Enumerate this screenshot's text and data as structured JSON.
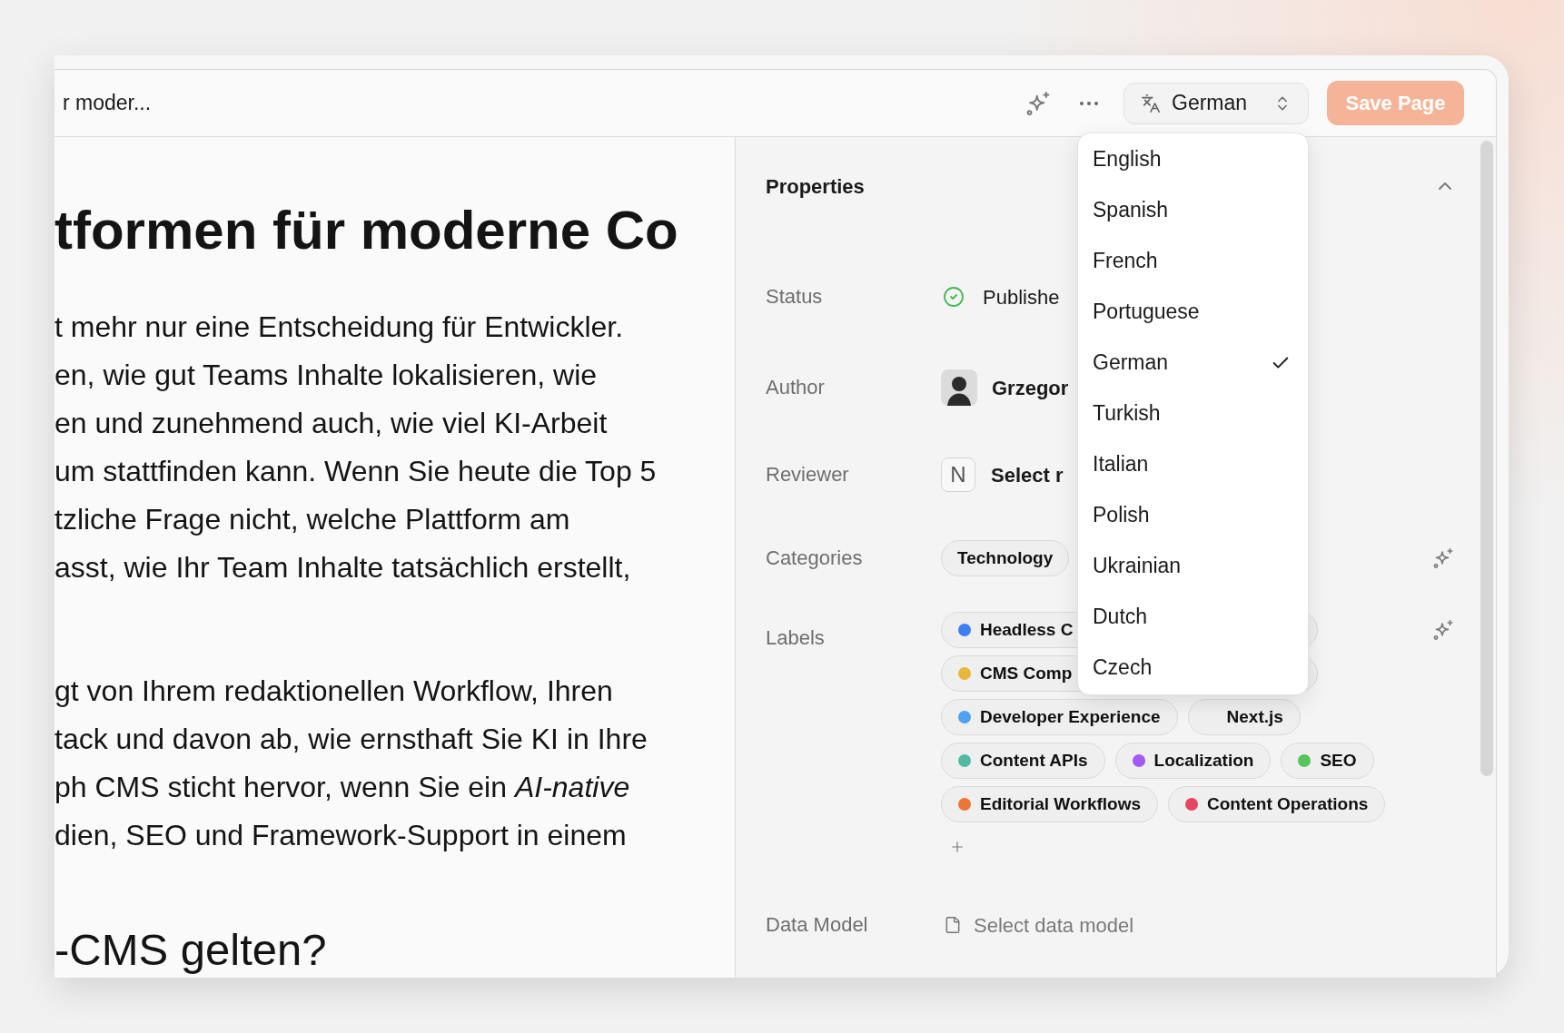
{
  "window": {
    "title": "r moder..."
  },
  "toolbar": {
    "language_select": {
      "value": "German"
    },
    "save_button": {
      "label": "Save Page",
      "disabled": true
    }
  },
  "language_menu": {
    "options": [
      {
        "label": "English",
        "selected": false
      },
      {
        "label": "Spanish",
        "selected": false
      },
      {
        "label": "French",
        "selected": false
      },
      {
        "label": "Portuguese",
        "selected": false
      },
      {
        "label": "German",
        "selected": true
      },
      {
        "label": "Turkish",
        "selected": false
      },
      {
        "label": "Italian",
        "selected": false
      },
      {
        "label": "Polish",
        "selected": false
      },
      {
        "label": "Ukrainian",
        "selected": false
      },
      {
        "label": "Dutch",
        "selected": false
      },
      {
        "label": "Czech",
        "selected": false
      }
    ]
  },
  "document": {
    "heading": "tformen für moderne Co",
    "paragraphs": [
      {
        "lines": [
          "t mehr nur eine Entscheidung für Entwickler.",
          "en, wie gut Teams Inhalte lokalisieren, wie",
          "en und zunehmend auch, wie viel KI-Arbeit",
          "um stattfinden kann. Wenn Sie heute die Top 5",
          "tzliche Frage nicht, welche Plattform am",
          "asst, wie Ihr Team Inhalte tatsächlich erstellt,"
        ]
      },
      {
        "lines": [
          "gt von Ihrem redaktionellen Workflow, Ihren",
          "tack und davon ab, wie ernsthaft Sie KI in Ihre",
          "ph CMS sticht hervor, wenn Sie ein *AI-native*",
          "dien, SEO und Framework-Support in einem"
        ]
      }
    ],
    "subheading": "-CMS gelten?"
  },
  "properties": {
    "title": "Properties",
    "expanded": true,
    "status": {
      "label": "Status",
      "value": "Publishe"
    },
    "author": {
      "label": "Author",
      "name": "Grzegor"
    },
    "reviewer": {
      "label": "Reviewer",
      "initial": "N",
      "value": "Select r"
    },
    "categories": {
      "label": "Categories",
      "items": [
        "Technology"
      ]
    },
    "labels": {
      "label": "Labels",
      "rows": [
        [
          {
            "text": "Headless C",
            "color": "#3f7ef5"
          }
        ],
        [
          {
            "text": "CMS Comp",
            "color": "#e9b63c"
          }
        ],
        [
          {
            "text": "Developer Experience",
            "color": "#4ea1ee"
          },
          {
            "text": "Next.js"
          }
        ],
        [
          {
            "text": "Content APIs",
            "color": "#52b9a4"
          },
          {
            "text": "Localization",
            "color": "#a35af2"
          },
          {
            "text": "SEO",
            "color": "#56c55c"
          }
        ],
        [
          {
            "text": "Editorial Workflows",
            "color": "#ee7635"
          },
          {
            "text": "Content Operations",
            "color": "#e44560"
          }
        ]
      ]
    },
    "data_model": {
      "label": "Data Model",
      "placeholder": "Select data model"
    }
  }
}
